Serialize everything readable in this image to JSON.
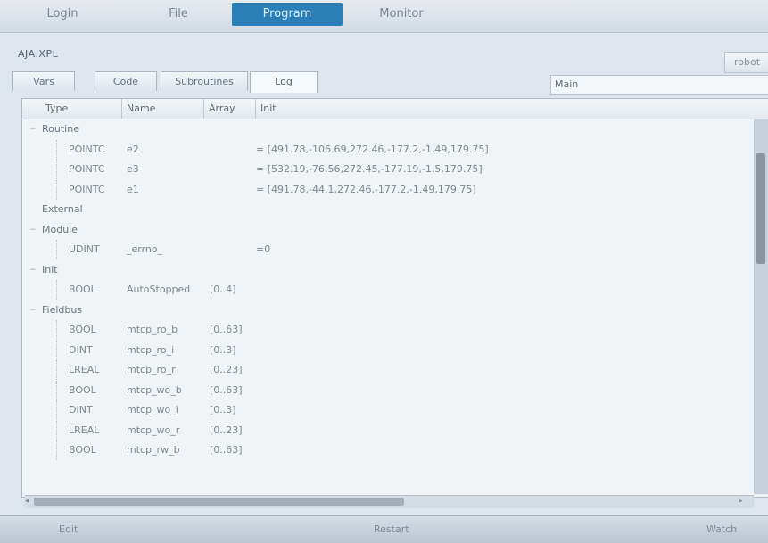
{
  "top_tabs": [
    {
      "label": "Login",
      "active": false
    },
    {
      "label": "File",
      "active": false
    },
    {
      "label": "Program",
      "active": true
    },
    {
      "label": "Monitor",
      "active": false
    }
  ],
  "window_title": "AJA.XPL",
  "robot_button": "robot",
  "sub_tabs": [
    {
      "label": "Vars",
      "active": false
    },
    {
      "label": "Code",
      "active": false
    },
    {
      "label": "Subroutines",
      "active": false
    },
    {
      "label": "Log",
      "active": true
    }
  ],
  "routine_select": {
    "value": "Main"
  },
  "columns": {
    "type": "Type",
    "name": "Name",
    "array": "Array",
    "init": "Init"
  },
  "rows": [
    {
      "kind": "group",
      "label": "Routine",
      "expand": "−"
    },
    {
      "kind": "var",
      "type": "POINTC",
      "name": "e2",
      "array": "",
      "init": "= [491.78,-106.69,272.46,-177.2,-1.49,179.75]"
    },
    {
      "kind": "var",
      "type": "POINTC",
      "name": "e3",
      "array": "",
      "init": "= [532.19,-76.56,272.45,-177.19,-1.5,179.75]"
    },
    {
      "kind": "var",
      "type": "POINTC",
      "name": "e1",
      "array": "",
      "init": "= [491.78,-44.1,272.46,-177.2,-1.49,179.75]"
    },
    {
      "kind": "group",
      "label": "External",
      "expand": ""
    },
    {
      "kind": "group",
      "label": "Module",
      "expand": "−"
    },
    {
      "kind": "var",
      "type": "UDINT",
      "name": "_errno_",
      "array": "",
      "init": "=0"
    },
    {
      "kind": "group",
      "label": "Init",
      "expand": "−"
    },
    {
      "kind": "var",
      "type": "BOOL",
      "name": "AutoStopped",
      "array": "[0..4]",
      "init": ""
    },
    {
      "kind": "group",
      "label": "Fieldbus",
      "expand": "−"
    },
    {
      "kind": "var",
      "type": "BOOL",
      "name": "mtcp_ro_b",
      "array": "[0..63]",
      "init": ""
    },
    {
      "kind": "var",
      "type": "DINT",
      "name": "mtcp_ro_i",
      "array": "[0..3]",
      "init": ""
    },
    {
      "kind": "var",
      "type": "LREAL",
      "name": "mtcp_ro_r",
      "array": "[0..23]",
      "init": ""
    },
    {
      "kind": "var",
      "type": "BOOL",
      "name": "mtcp_wo_b",
      "array": "[0..63]",
      "init": ""
    },
    {
      "kind": "var",
      "type": "DINT",
      "name": "mtcp_wo_i",
      "array": "[0..3]",
      "init": ""
    },
    {
      "kind": "var",
      "type": "LREAL",
      "name": "mtcp_wo_r",
      "array": "[0..23]",
      "init": ""
    },
    {
      "kind": "var",
      "type": "BOOL",
      "name": "mtcp_rw_b",
      "array": "[0..63]",
      "init": ""
    }
  ],
  "bottom_bar": {
    "left": "Edit",
    "center": "Restart",
    "right": "Watch"
  },
  "icons": {
    "expand": "minus-icon",
    "dropdown": "chevron-down-icon",
    "scroll_left": "arrow-left-icon",
    "scroll_right": "arrow-right-icon"
  },
  "colors": {
    "accent": "#2a7fb8",
    "panel": "#f0f4f7"
  }
}
